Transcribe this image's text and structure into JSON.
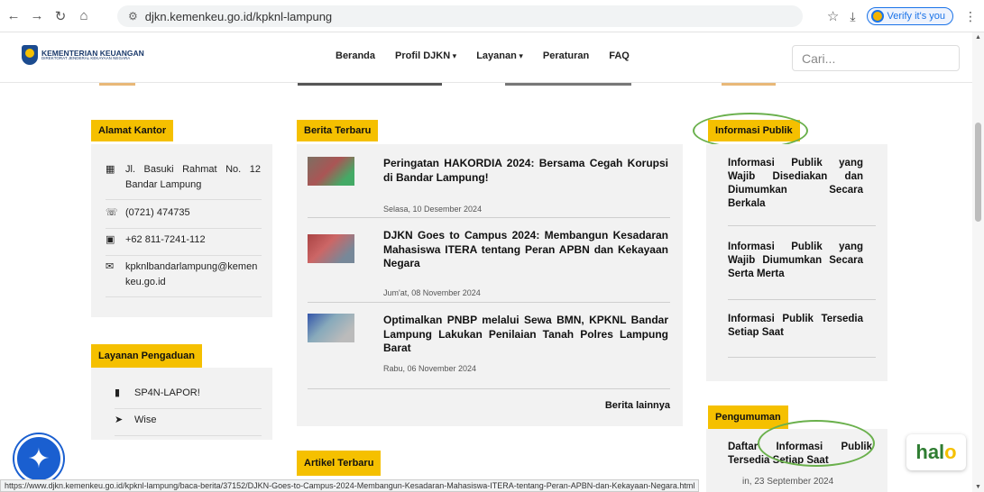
{
  "browser": {
    "url": "djkn.kemenkeu.go.id/kpknl-lampung",
    "verify_label": "Verify it's you"
  },
  "header": {
    "logo_line1": "KEMENTERIAN KEUANGAN",
    "logo_line2": "DIREKTORAT JENDERAL KEKAYAAN NEGARA",
    "nav": [
      "Beranda",
      "Profil DJKN",
      "Layanan",
      "Peraturan",
      "FAQ"
    ],
    "search_placeholder": "Cari..."
  },
  "alamat": {
    "tag": "Alamat Kantor",
    "address": "Jl. Basuki Rahmat No. 12 Bandar Lampung",
    "phone": "(0721) 474735",
    "whatsapp": "+62 811-7241-112",
    "email": "kpknlbandarlampung@kemenkeu.go.id"
  },
  "pengaduan": {
    "tag": "Layanan Pengaduan",
    "items": [
      "SP4N-LAPOR!",
      "Wise"
    ]
  },
  "berita": {
    "tag": "Berita Terbaru",
    "items": [
      {
        "title": "Peringatan HAKORDIA 2024: Bersama Cegah Korupsi di Bandar Lampung!",
        "date": "Selasa, 10 Desember 2024"
      },
      {
        "title": "DJKN Goes to Campus 2024: Membangun Kesadaran Mahasiswa ITERA tentang Peran APBN dan Kekayaan Negara",
        "date": "Jum'at, 08 November 2024"
      },
      {
        "title": "Optimalkan PNBP melalui Sewa BMN, KPKNL Bandar Lampung Lakukan Penilaian Tanah Polres Lampung Barat",
        "date": "Rabu, 06 November 2024"
      }
    ],
    "more": "Berita lainnya"
  },
  "artikel": {
    "tag": "Artikel Terbaru"
  },
  "informasi": {
    "tag": "Informasi Publik",
    "items": [
      "Informasi Publik yang Wajib Disediakan dan Diumumkan Secara Berkala",
      "Informasi Publik yang Wajib Diumumkan Secara Serta Merta",
      "Informasi Publik Tersedia Setiap Saat"
    ]
  },
  "pengumuman": {
    "tag": "Pengumuman",
    "item_title": "Daftar Informasi Publik Tersedia Setiap Saat",
    "item_date": "in, 23 September 2024"
  },
  "status_url": "https://www.djkn.kemenkeu.go.id/kpknl-lampung/baca-berita/37152/DJKN-Goes-to-Campus-2024-Membangun-Kesadaran-Mahasiswa-ITERA-tentang-Peran-APBN-dan-Kekayaan-Negara.html",
  "halo_label": "hal",
  "halo_accent": "o",
  "colors": {
    "accent": "#f5c000",
    "highlight_oval": "#6ab04c",
    "accessibility": "#1a5fd0"
  }
}
